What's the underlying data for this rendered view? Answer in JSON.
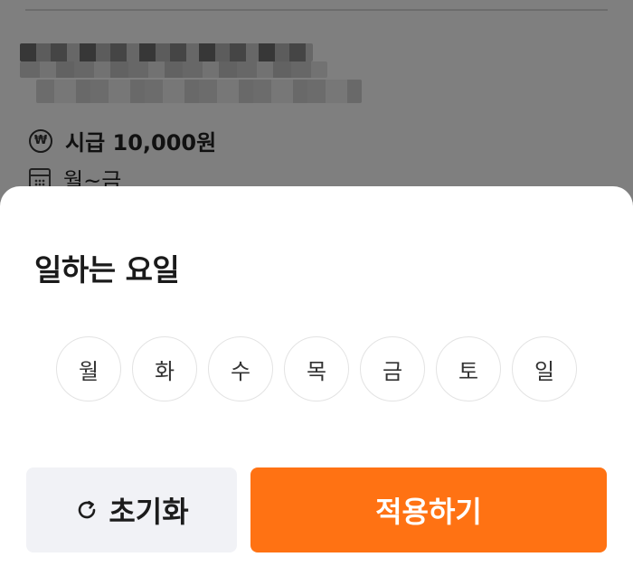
{
  "background": {
    "wage_text": "시급 10,000원",
    "days_text": "월~금",
    "wage_icon": "won-icon",
    "days_icon": "calendar-icon"
  },
  "sheet": {
    "title": "일하는 요일",
    "days": [
      "월",
      "화",
      "수",
      "목",
      "금",
      "토",
      "일"
    ],
    "reset_label": "초기화",
    "reset_icon": "refresh-icon",
    "apply_label": "적용하기"
  },
  "colors": {
    "accent": "#ff7213",
    "reset_bg": "#f1f2f6",
    "overlay": "rgba(0,0,0,0.5)"
  }
}
